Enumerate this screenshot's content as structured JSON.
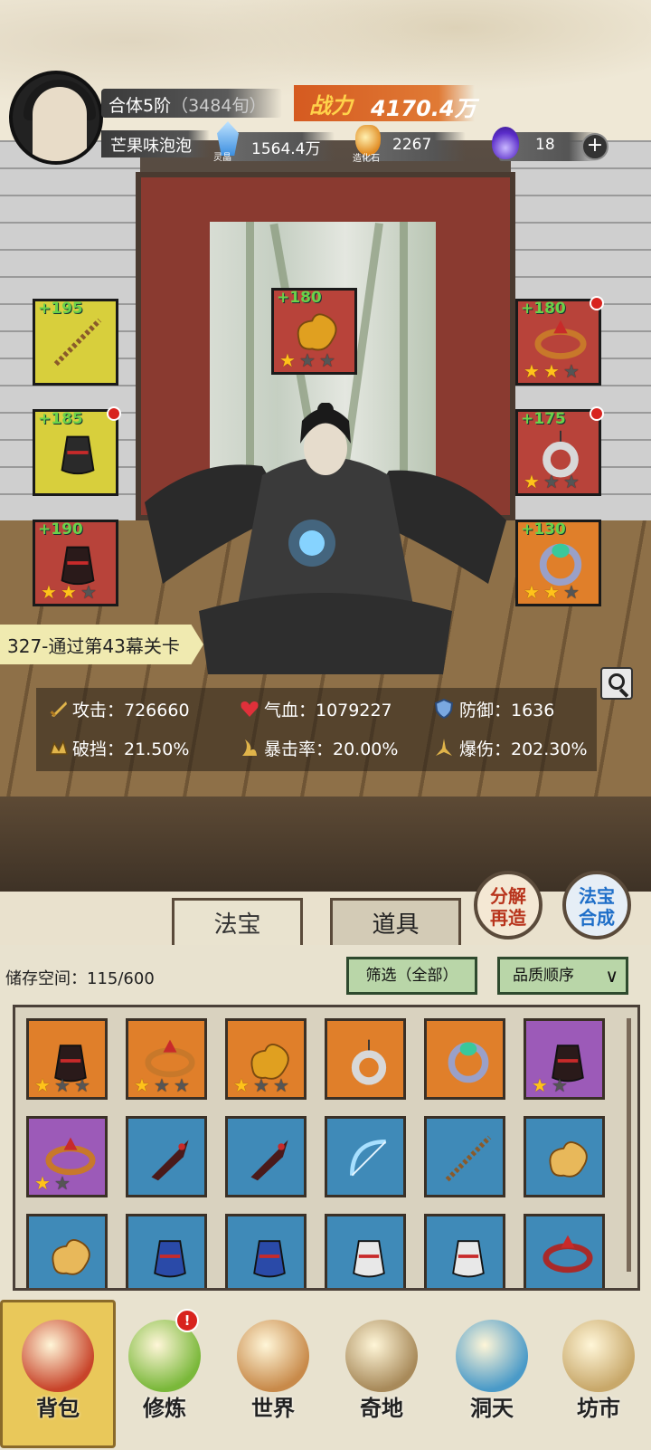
{
  "header": {
    "realm_label": "合体5阶",
    "realm_detail": "（3484旬）",
    "power_label": "战力",
    "power_value": "4170.4万",
    "player_name": "芒果味泡泡",
    "resources": [
      {
        "icon": "spirit-crystal-icon",
        "label": "灵晶",
        "value": "1564.4万"
      },
      {
        "icon": "creation-stone-icon",
        "label": "造化石",
        "value": "2267"
      },
      {
        "icon": "purple-flame-icon",
        "label": "",
        "value": "18"
      }
    ]
  },
  "equipment": {
    "left": [
      {
        "level": "+195",
        "color": "#d8cf3c",
        "icon": "chain-whip-icon",
        "stars": 0,
        "max_stars": 0,
        "alert": false
      },
      {
        "level": "+185",
        "color": "#d8cf3c",
        "icon": "dark-robe-icon",
        "stars": 0,
        "max_stars": 0,
        "alert": true
      },
      {
        "level": "+190",
        "color": "#b8433a",
        "icon": "gauntlet-icon",
        "stars": 2,
        "max_stars": 3,
        "alert": false
      }
    ],
    "top": {
      "level": "+180",
      "color": "#b8433a",
      "icon": "golden-cloud-icon",
      "stars": 1,
      "max_stars": 3,
      "alert": false
    },
    "right": [
      {
        "level": "+180",
        "color": "#b8433a",
        "icon": "headband-icon",
        "stars": 2,
        "max_stars": 3,
        "alert": true
      },
      {
        "level": "+175",
        "color": "#b8433a",
        "icon": "jade-pendant-icon",
        "stars": 1,
        "max_stars": 3,
        "alert": true
      },
      {
        "level": "+130",
        "color": "#e07f2a",
        "icon": "jade-ring-icon",
        "stars": 2,
        "max_stars": 3,
        "alert": false
      }
    ]
  },
  "stage": "327-通过第43幕关卡",
  "stats": [
    {
      "icon": "attack-icon",
      "label": "攻击：726660"
    },
    {
      "icon": "health-heart-icon",
      "label": "气血：1079227"
    },
    {
      "icon": "defense-shield-icon",
      "label": "防御：1636"
    },
    {
      "icon": "break-block-icon",
      "label": "破挡：21.50%"
    },
    {
      "icon": "crit-rate-icon",
      "label": "暴击率：20.00%"
    },
    {
      "icon": "crit-damage-icon",
      "label": "爆伤：202.30%"
    }
  ],
  "tabs": [
    "法宝",
    "道具"
  ],
  "circle_buttons": [
    {
      "line1": "分解",
      "line2": "再造"
    },
    {
      "line1": "法宝",
      "line2": "合成"
    }
  ],
  "inventory": {
    "storage_label": "储存空间：115/600",
    "filter_label": "筛选（全部）",
    "sort_label": "品质顺序",
    "rows": [
      [
        {
          "color": "#e07f2a",
          "icon": "gauntlet-icon",
          "stars": 1,
          "max_stars": 3
        },
        {
          "color": "#e07f2a",
          "icon": "headband-icon",
          "stars": 1,
          "max_stars": 3
        },
        {
          "color": "#e07f2a",
          "icon": "golden-cloud-icon",
          "stars": 1,
          "max_stars": 3
        },
        {
          "color": "#e07f2a",
          "icon": "jade-pendant-icon",
          "stars": 0,
          "max_stars": 0
        },
        {
          "color": "#e07f2a",
          "icon": "jade-ring-icon",
          "stars": 0,
          "max_stars": 0
        },
        {
          "color": "#9c5ab8",
          "icon": "gauntlet-icon",
          "stars": 1,
          "max_stars": 2
        }
      ],
      [
        {
          "color": "#9c5ab8",
          "icon": "headband-icon",
          "stars": 1,
          "max_stars": 2
        },
        {
          "color": "#3f8ab8",
          "icon": "dark-dagger-icon",
          "stars": 0,
          "max_stars": 0
        },
        {
          "color": "#3f8ab8",
          "icon": "dark-dagger-icon",
          "stars": 0,
          "max_stars": 0
        },
        {
          "color": "#3f8ab8",
          "icon": "ice-bow-icon",
          "stars": 0,
          "max_stars": 0
        },
        {
          "color": "#3f8ab8",
          "icon": "chain-whip-icon",
          "stars": 0,
          "max_stars": 0
        },
        {
          "color": "#3f8ab8",
          "icon": "golden-flower-icon",
          "stars": 0,
          "max_stars": 0
        }
      ],
      [
        {
          "color": "#3f8ab8",
          "icon": "golden-flower-icon",
          "stars": 0,
          "max_stars": 0
        },
        {
          "color": "#3f8ab8",
          "icon": "blue-robe-icon",
          "stars": 0,
          "max_stars": 0
        },
        {
          "color": "#3f8ab8",
          "icon": "blue-robe-icon",
          "stars": 0,
          "max_stars": 0
        },
        {
          "color": "#3f8ab8",
          "icon": "white-armor-icon",
          "stars": 0,
          "max_stars": 0
        },
        {
          "color": "#3f8ab8",
          "icon": "white-armor-icon",
          "stars": 0,
          "max_stars": 0
        },
        {
          "color": "#3f8ab8",
          "icon": "red-crown-icon",
          "stars": 0,
          "max_stars": 0
        }
      ]
    ]
  },
  "nav": [
    {
      "label": "背包",
      "icon": "backpack-icon",
      "selected": true,
      "badge": ""
    },
    {
      "label": "修炼",
      "icon": "cultivate-lotus-icon",
      "selected": false,
      "badge": "!"
    },
    {
      "label": "世界",
      "icon": "world-scroll-icon",
      "selected": false,
      "badge": ""
    },
    {
      "label": "奇地",
      "icon": "wonder-land-icon",
      "selected": false,
      "badge": ""
    },
    {
      "label": "洞天",
      "icon": "cave-heaven-icon",
      "selected": false,
      "badge": ""
    },
    {
      "label": "坊市",
      "icon": "market-icon",
      "selected": false,
      "badge": ""
    }
  ]
}
